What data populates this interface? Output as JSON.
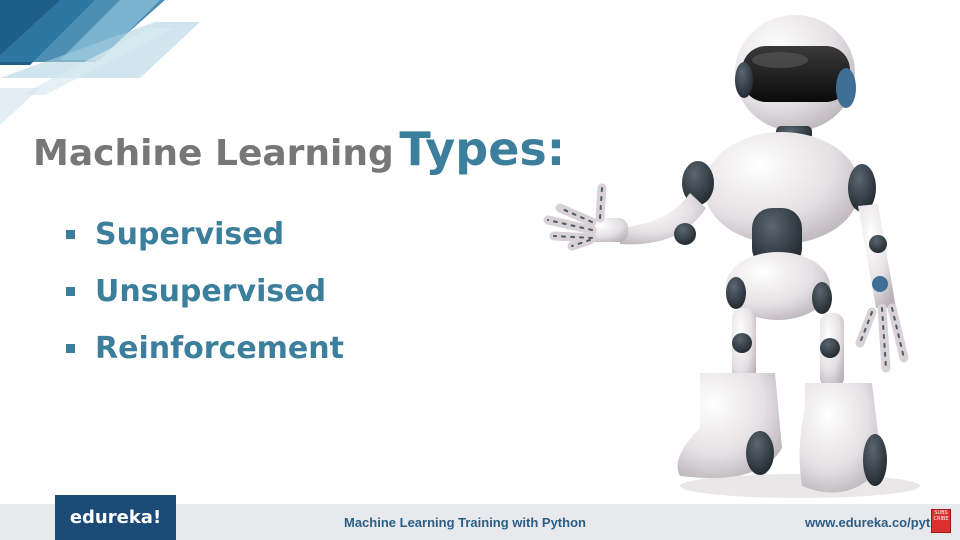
{
  "slide": {
    "title_part1": "Machine Learning",
    "title_part2": "Types:",
    "bullets": [
      "Supervised",
      "Unsupervised",
      "Reinforcement"
    ]
  },
  "footer": {
    "logo_text": "edureka!",
    "course_title": "Machine Learning Training with Python",
    "url": "www.edureka.co/pyth",
    "subscribe_lines": [
      "SUBS",
      "CRIBE"
    ]
  },
  "colors": {
    "accent": "#3b7f9d",
    "title_gray": "#777777",
    "logo_bg": "#1d4b77",
    "footer_bg": "#e7e9ec",
    "footer_text": "#2b5d85"
  },
  "icons": {
    "bullet": "square-bullet-icon",
    "robot": "robot-illustration",
    "subscribe": "subscribe-icon"
  }
}
